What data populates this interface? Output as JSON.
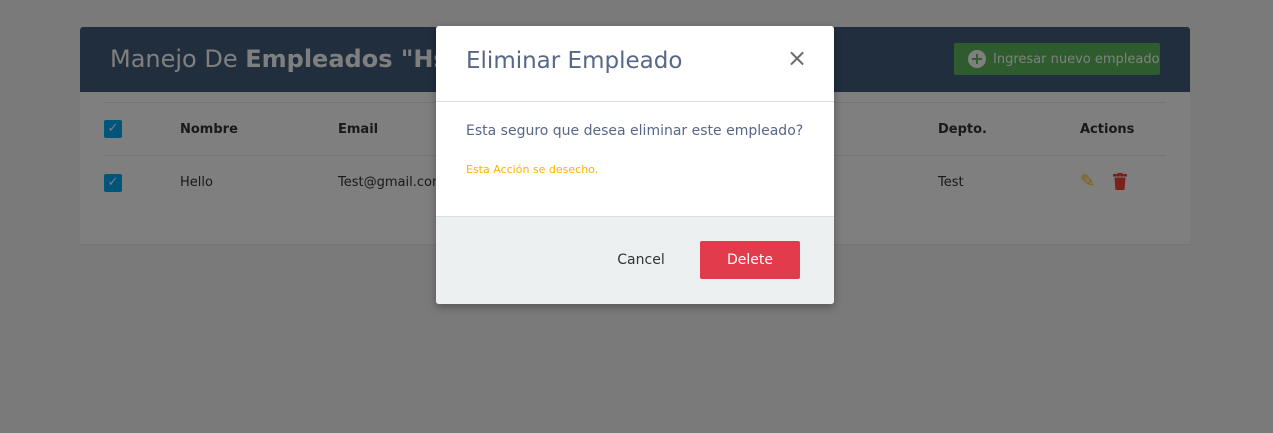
{
  "header": {
    "title_prefix": "Manejo De ",
    "title_bold": "Empleados \"Hsha",
    "add_button_label": "Ingresar nuevo empleado"
  },
  "table": {
    "columns": [
      "Nombre",
      "Email",
      "Depto.",
      "Actions"
    ],
    "rows": [
      {
        "nombre": "Hello",
        "email": "Test@gmail.com",
        "depto": "Test"
      }
    ]
  },
  "modal": {
    "title": "Eliminar Empleado",
    "close_glyph": "×",
    "message": "Esta seguro que desea eliminar este empleado?",
    "warning": "Esta Acción se desecho.",
    "cancel_label": "Cancel",
    "delete_label": "Delete"
  },
  "colors": {
    "header_bg": "#435d7d",
    "add_button": "#5cb85c",
    "checkbox": "#03a9f4",
    "edit_icon": "#ffc107",
    "delete_icon": "#f44336",
    "delete_button": "#e23c4c",
    "warning_text": "#ffb100",
    "modal_footer_bg": "#ecf0f1"
  }
}
